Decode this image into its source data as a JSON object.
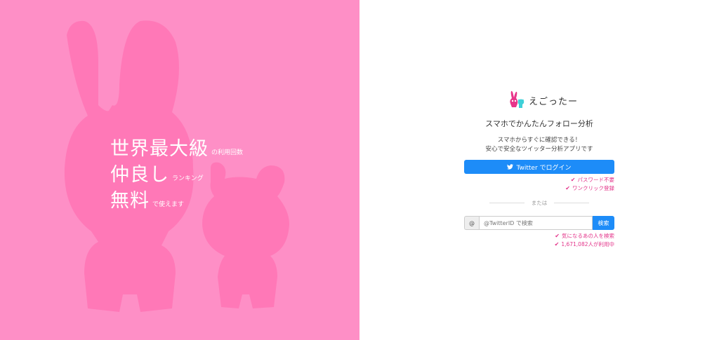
{
  "colors": {
    "left_bg": "#fe8fc6",
    "mascot": "#ff78b7",
    "accent": "#1d8cf8",
    "note": "#e3348a"
  },
  "hero": {
    "lines": [
      {
        "big": "世界最大級",
        "small": "の利用回数"
      },
      {
        "big": "仲良し",
        "small": "ランキング"
      },
      {
        "big": "無料",
        "small": "で使えます"
      }
    ]
  },
  "brand": {
    "name": "えごったー",
    "logo_icon": "bunny-bear-logo-icon"
  },
  "subtitle": "スマホでかんたんフォロー分析",
  "description": [
    "スマホからすぐに確認できる！",
    "安心で安全なツイッター分析アプリです"
  ],
  "login": {
    "button_label": "Twitter でログイン",
    "icon": "twitter-bird-icon",
    "notes": [
      "パスワード不要",
      "ワンクリック登録"
    ]
  },
  "divider": "または",
  "search": {
    "prefix": "@",
    "placeholder": "@TwitterID で検索",
    "button_label": "検索",
    "notes": [
      "気になるあの人を検索",
      "1,671,082人が利用中"
    ]
  }
}
